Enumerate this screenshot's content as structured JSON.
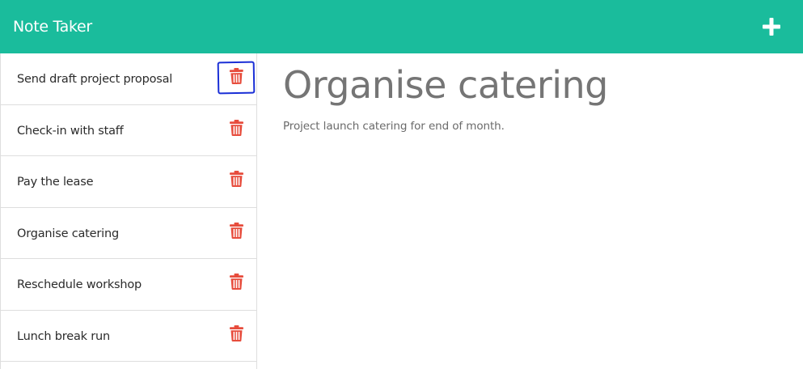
{
  "header": {
    "title": "Note Taker",
    "add_icon": "plus-icon"
  },
  "colors": {
    "navbar": "#1abc9c",
    "delete_icon": "#e74c3c",
    "selection_outline": "#1a2fd6"
  },
  "sidebar": {
    "notes": [
      {
        "title": "Send draft project proposal",
        "icon": "trash-icon",
        "highlighted": true
      },
      {
        "title": "Check-in with staff",
        "icon": "trash-icon"
      },
      {
        "title": "Pay the lease",
        "icon": "trash-icon"
      },
      {
        "title": "Organise catering",
        "icon": "trash-icon"
      },
      {
        "title": "Reschedule workshop",
        "icon": "trash-icon"
      },
      {
        "title": "Lunch break run",
        "icon": "trash-icon"
      }
    ]
  },
  "main": {
    "note_title": "Organise catering",
    "note_text": "Project launch catering for end of month."
  }
}
